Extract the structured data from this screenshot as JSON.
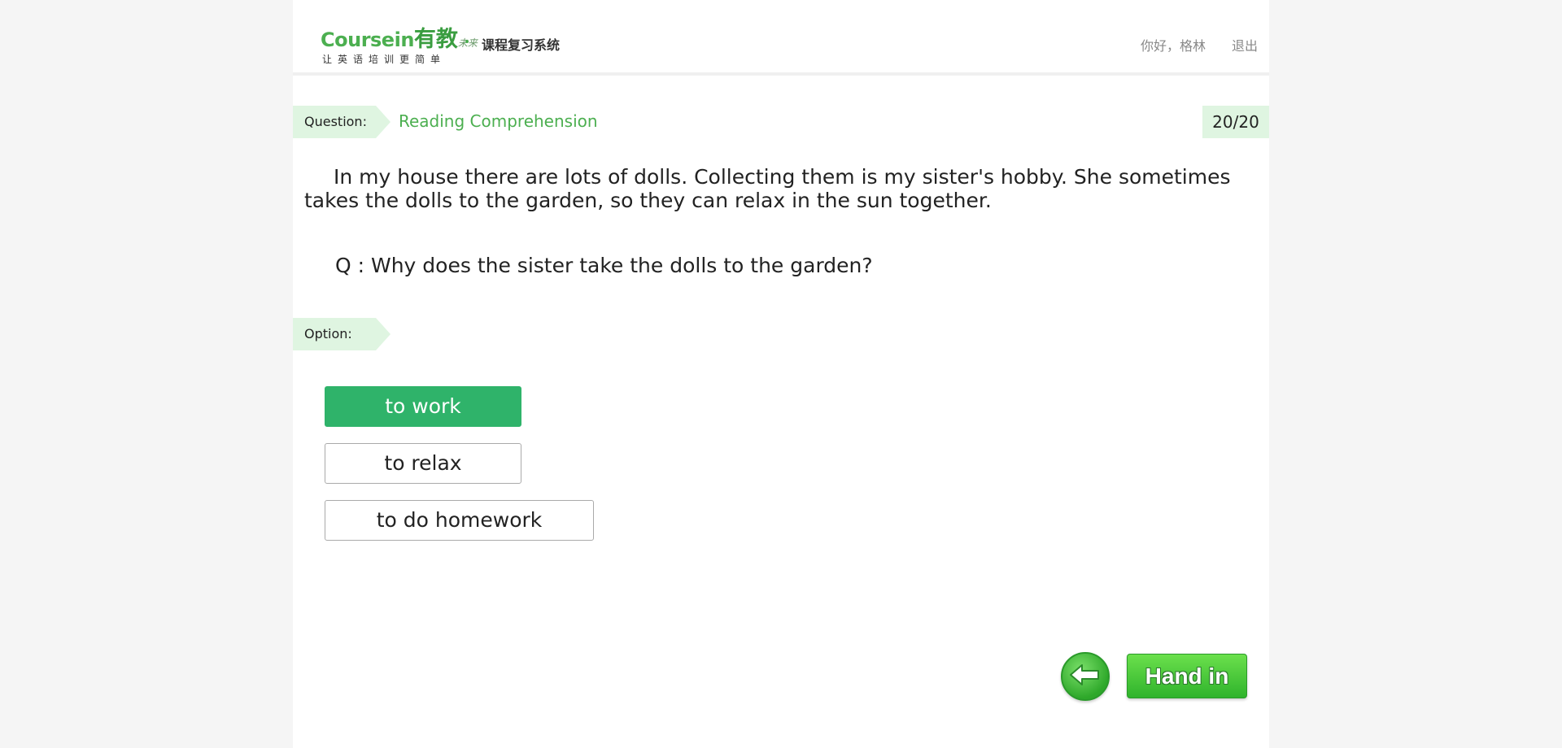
{
  "header": {
    "logo": {
      "course": "Coursein",
      "chinese": "有教",
      "sub": "未来",
      "system": "课程复习系统",
      "tagline": "让英语培训更简单"
    },
    "greeting": "你好，格林",
    "logout": "退出"
  },
  "question": {
    "tag_label": "Question:",
    "type": "Reading Comprehension",
    "counter": "20/20",
    "passage": "In my house there are lots of dolls. Collecting them is my sister's hobby. She sometimes takes the dolls to the garden, so they can relax in the sun together.",
    "prompt": "Q : Why does the sister take the dolls to the garden?"
  },
  "options": {
    "tag_label": "Option:",
    "items": [
      {
        "label": "to work",
        "selected": true
      },
      {
        "label": "to relax",
        "selected": false
      },
      {
        "label": "to do homework",
        "selected": false
      }
    ]
  },
  "actions": {
    "back_icon": "arrow-left-icon",
    "hand_in_label": "Hand in"
  },
  "colors": {
    "accent": "#4caf50",
    "selected_option": "#2fb36a",
    "tag_background": "#dff5e1",
    "button_green": "#3cc43a"
  }
}
